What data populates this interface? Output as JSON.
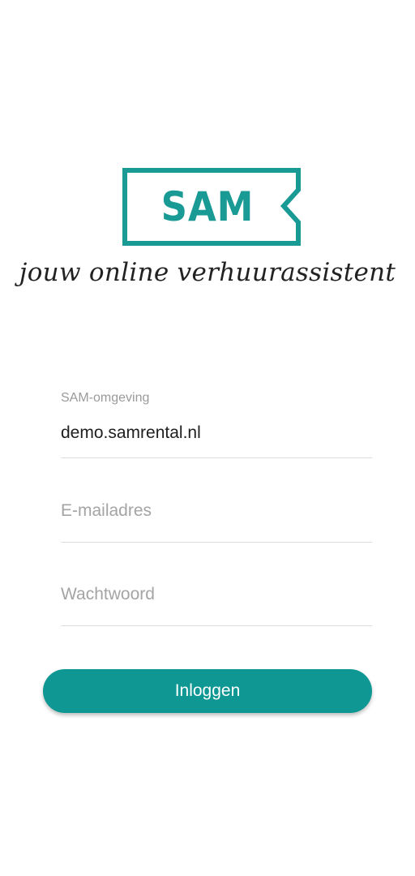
{
  "logo": {
    "text": "SAM",
    "tagline": "jouw online verhuurassistent",
    "color": "#1a9a94"
  },
  "form": {
    "environment": {
      "label": "SAM-omgeving",
      "value": "demo.samrental.nl"
    },
    "email": {
      "placeholder": "E-mailadres"
    },
    "password": {
      "placeholder": "Wachtwoord"
    },
    "submit_label": "Inloggen"
  },
  "colors": {
    "accent": "#0f9793",
    "divider": "#dedede"
  }
}
